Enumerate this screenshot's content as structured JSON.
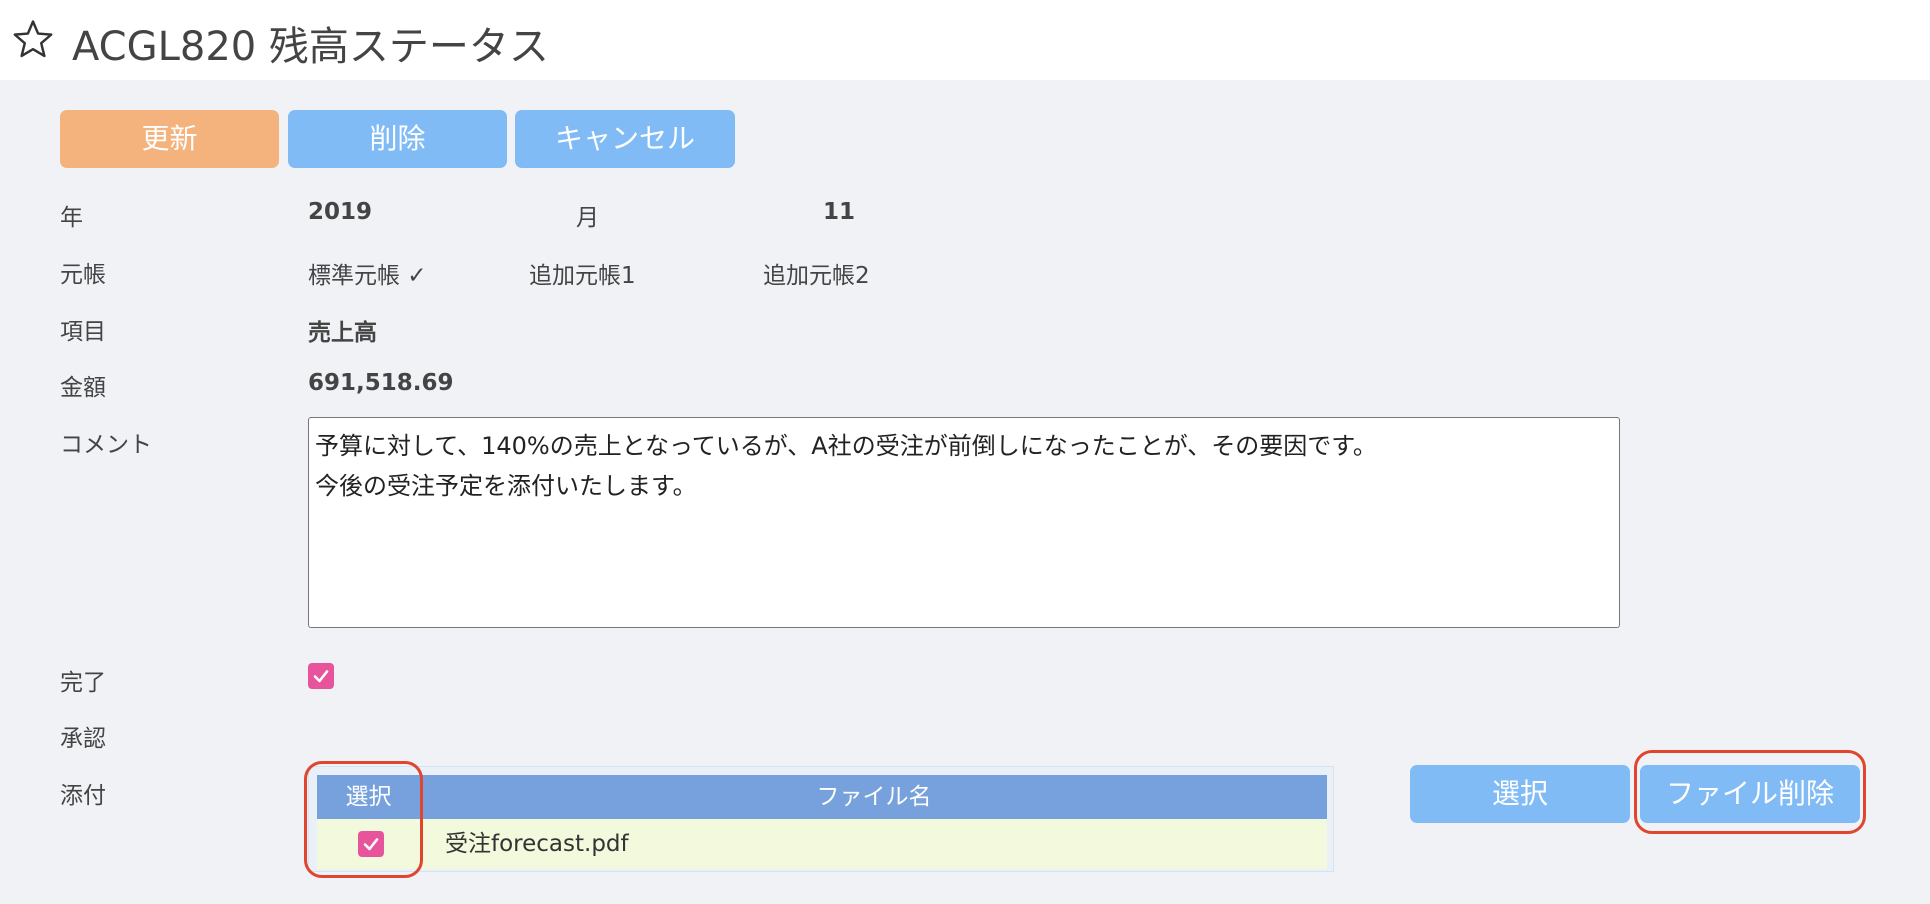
{
  "header": {
    "title": "ACGL820 残高ステータス",
    "star_icon": "star-outline-icon"
  },
  "toolbar": {
    "update_label": "更新",
    "delete_label": "削除",
    "cancel_label": "キャンセル"
  },
  "form": {
    "year_label": "年",
    "year_value": "2019",
    "month_label": "月",
    "month_value": "11",
    "ledger_label": "元帳",
    "ledger_options": [
      "標準元帳 ✓",
      "追加元帳1",
      "追加元帳2"
    ],
    "item_label": "項目",
    "item_value": "売上高",
    "amount_label": "金額",
    "amount_value": "691,518.69",
    "comment_label": "コメント",
    "comment_value": "予算に対して、140%の売上となっているが、A社の受注が前倒しになったことが、その要因です。\n今後の受注予定を添付いたします。",
    "completed_label": "完了",
    "completed_checked": true,
    "approval_label": "承認",
    "attachment_label": "添付"
  },
  "attachments": {
    "columns": [
      "選択",
      "ファイル名"
    ],
    "rows": [
      {
        "selected": true,
        "file_name": "受注forecast.pdf"
      }
    ],
    "select_button_label": "選択",
    "delete_file_button_label": "ファイル削除"
  },
  "colors": {
    "accent_orange": "#f4b27c",
    "accent_blue": "#80bbf6",
    "checkbox_pink": "#e7549c",
    "table_header": "#76a1dc",
    "highlight_red": "#e0452f"
  }
}
